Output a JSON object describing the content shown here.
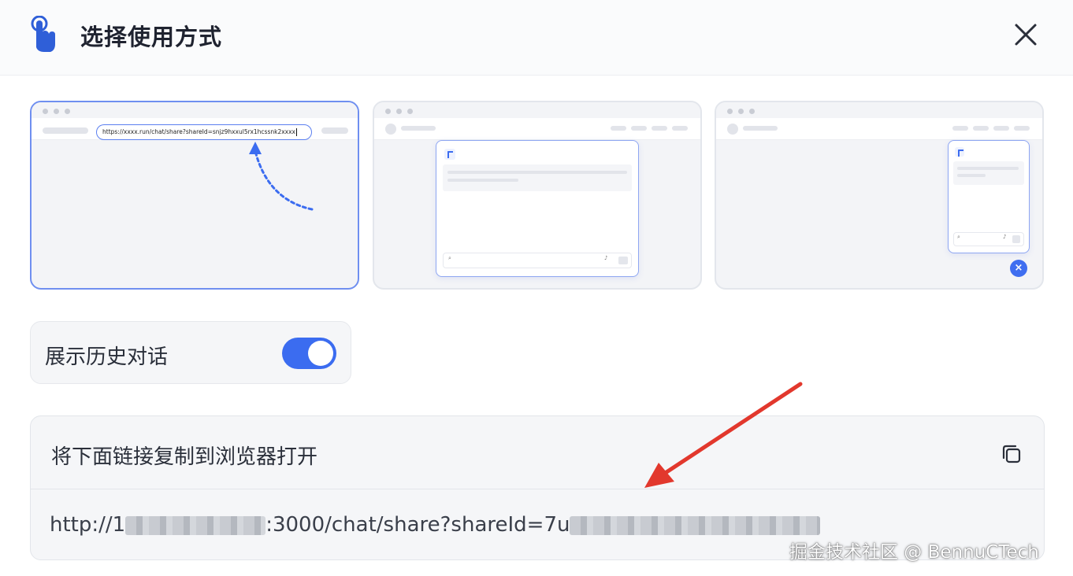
{
  "header": {
    "title": "选择使用方式"
  },
  "modes": [
    {
      "name": "share-link",
      "selected": true,
      "url_preview": "https://xxxx.run/chat/share?shareId=snjz9hxxul5rx1hcssnk2xxxx"
    },
    {
      "name": "embed-window",
      "selected": false
    },
    {
      "name": "floating-bubble",
      "selected": false
    }
  ],
  "history_toggle": {
    "label": "展示历史对话",
    "enabled": true
  },
  "link_panel": {
    "label": "将下面链接复制到浏览器打开",
    "url_prefix": "http://1",
    "url_middle": ":3000/chat/share?shareId=7u"
  },
  "watermark": "掘金技术社区 @ BennuCTech",
  "colors": {
    "accent": "#3b6cf0",
    "selected_border": "#6f8ff0",
    "annotation_arrow": "#e2382d"
  },
  "icons": {
    "header": "pointer-hand-icon",
    "close": "close-icon",
    "copy": "copy-icon"
  }
}
